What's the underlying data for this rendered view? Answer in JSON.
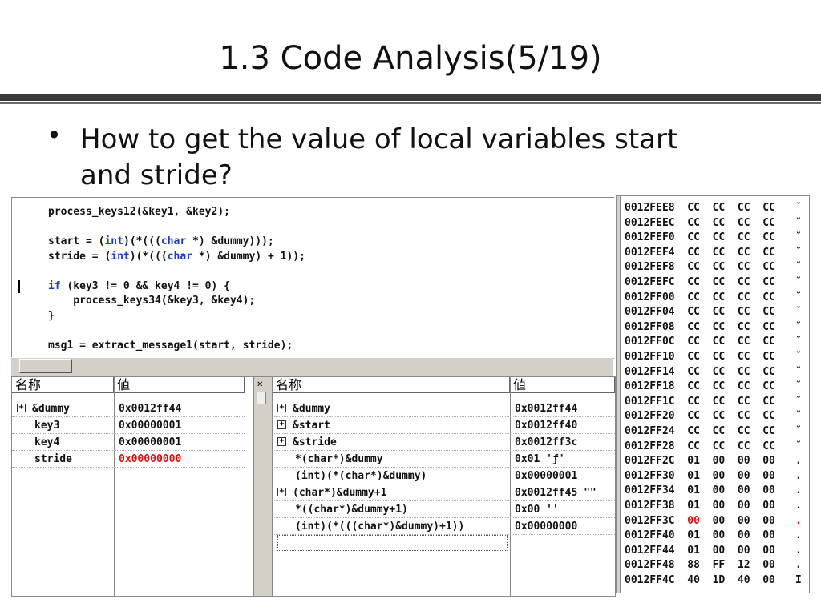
{
  "slide": {
    "title": "1.3 Code Analysis(5/19)",
    "bullet": "•",
    "bullet_text": "How to get the value of local variables start and stride?"
  },
  "editor": {
    "lines": [
      "process_keys12(&key1, &key2);",
      "",
      "start = (int)(*(((char *) &dummy)));",
      "stride = (int)(*(((char *) &dummy) + 1));",
      "",
      "if (key3 != 0 && key4 != 0) {",
      "    process_keys34(&key3, &key4);",
      "}",
      "",
      "msg1 = extract_message1(start, stride);"
    ]
  },
  "locals_panel": {
    "header_name": "名称",
    "header_value": "値",
    "rows": [
      {
        "name": "&dummy",
        "value": "0x0012ff44",
        "expand": true,
        "changed": false
      },
      {
        "name": "key3",
        "value": "0x00000001",
        "expand": false,
        "changed": false
      },
      {
        "name": "key4",
        "value": "0x00000001",
        "expand": false,
        "changed": false
      },
      {
        "name": "stride",
        "value": "0x00000000",
        "expand": false,
        "changed": true
      }
    ]
  },
  "watch_panel": {
    "header_name": "名称",
    "header_value": "値",
    "rows": [
      {
        "name": "&dummy",
        "value": "0x0012ff44",
        "expand": true
      },
      {
        "name": "&start",
        "value": "0x0012ff40",
        "expand": true
      },
      {
        "name": "&stride",
        "value": "0x0012ff3c",
        "expand": true
      },
      {
        "name": "*(char*)&dummy",
        "value": "0x01 'ƒ'",
        "expand": false
      },
      {
        "name": "(int)(*(char*)&dummy)",
        "value": "0x00000001",
        "expand": false
      },
      {
        "name": "(char*)&dummy+1",
        "value": "0x0012ff45 \"\"",
        "expand": true
      },
      {
        "name": "*((char*)&dummy+1)",
        "value": "0x00 ''",
        "expand": false
      },
      {
        "name": "(int)(*(((char*)&dummy)+1))",
        "value": "0x00000000",
        "expand": false
      }
    ]
  },
  "memory": {
    "rows": [
      {
        "addr": "0012FEE8",
        "bytes": [
          "CC",
          "CC",
          "CC",
          "CC"
        ],
        "ascii": "̆"
      },
      {
        "addr": "0012FEEC",
        "bytes": [
          "CC",
          "CC",
          "CC",
          "CC"
        ],
        "ascii": "̆"
      },
      {
        "addr": "0012FEF0",
        "bytes": [
          "CC",
          "CC",
          "CC",
          "CC"
        ],
        "ascii": "̆"
      },
      {
        "addr": "0012FEF4",
        "bytes": [
          "CC",
          "CC",
          "CC",
          "CC"
        ],
        "ascii": "̆"
      },
      {
        "addr": "0012FEF8",
        "bytes": [
          "CC",
          "CC",
          "CC",
          "CC"
        ],
        "ascii": "̆"
      },
      {
        "addr": "0012FEFC",
        "bytes": [
          "CC",
          "CC",
          "CC",
          "CC"
        ],
        "ascii": "̆"
      },
      {
        "addr": "0012FF00",
        "bytes": [
          "CC",
          "CC",
          "CC",
          "CC"
        ],
        "ascii": "̆"
      },
      {
        "addr": "0012FF04",
        "bytes": [
          "CC",
          "CC",
          "CC",
          "CC"
        ],
        "ascii": "̆"
      },
      {
        "addr": "0012FF08",
        "bytes": [
          "CC",
          "CC",
          "CC",
          "CC"
        ],
        "ascii": "̆"
      },
      {
        "addr": "0012FF0C",
        "bytes": [
          "CC",
          "CC",
          "CC",
          "CC"
        ],
        "ascii": "̆"
      },
      {
        "addr": "0012FF10",
        "bytes": [
          "CC",
          "CC",
          "CC",
          "CC"
        ],
        "ascii": "̆"
      },
      {
        "addr": "0012FF14",
        "bytes": [
          "CC",
          "CC",
          "CC",
          "CC"
        ],
        "ascii": "̆"
      },
      {
        "addr": "0012FF18",
        "bytes": [
          "CC",
          "CC",
          "CC",
          "CC"
        ],
        "ascii": "̆"
      },
      {
        "addr": "0012FF1C",
        "bytes": [
          "CC",
          "CC",
          "CC",
          "CC"
        ],
        "ascii": "̆"
      },
      {
        "addr": "0012FF20",
        "bytes": [
          "CC",
          "CC",
          "CC",
          "CC"
        ],
        "ascii": "̆"
      },
      {
        "addr": "0012FF24",
        "bytes": [
          "CC",
          "CC",
          "CC",
          "CC"
        ],
        "ascii": "̆"
      },
      {
        "addr": "0012FF28",
        "bytes": [
          "CC",
          "CC",
          "CC",
          "CC"
        ],
        "ascii": "̆"
      },
      {
        "addr": "0012FF2C",
        "bytes": [
          "01",
          "00",
          "00",
          "00"
        ],
        "ascii": "."
      },
      {
        "addr": "0012FF30",
        "bytes": [
          "01",
          "00",
          "00",
          "00"
        ],
        "ascii": "."
      },
      {
        "addr": "0012FF34",
        "bytes": [
          "01",
          "00",
          "00",
          "00"
        ],
        "ascii": "."
      },
      {
        "addr": "0012FF38",
        "bytes": [
          "01",
          "00",
          "00",
          "00"
        ],
        "ascii": "."
      },
      {
        "addr": "0012FF3C",
        "bytes": [
          "00",
          "00",
          "00",
          "00"
        ],
        "ascii": ".",
        "changed": true
      },
      {
        "addr": "0012FF40",
        "bytes": [
          "01",
          "00",
          "00",
          "00"
        ],
        "ascii": "."
      },
      {
        "addr": "0012FF44",
        "bytes": [
          "01",
          "00",
          "00",
          "00"
        ],
        "ascii": "."
      },
      {
        "addr": "0012FF48",
        "bytes": [
          "88",
          "FF",
          "12",
          "00"
        ],
        "ascii": "."
      },
      {
        "addr": "0012FF4C",
        "bytes": [
          "40",
          "1D",
          "40",
          "00"
        ],
        "ascii": "I"
      }
    ]
  }
}
